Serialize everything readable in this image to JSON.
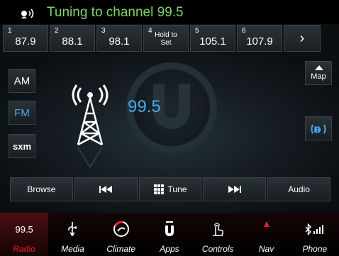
{
  "status": {
    "title": "Tuning to channel 99.5"
  },
  "presets": [
    {
      "num": "1",
      "freq": "87.9"
    },
    {
      "num": "2",
      "freq": "88.1"
    },
    {
      "num": "3",
      "freq": "98.1"
    },
    {
      "num": "4",
      "hold": "Hold to Set"
    },
    {
      "num": "5",
      "freq": "105.1"
    },
    {
      "num": "6",
      "freq": "107.9"
    }
  ],
  "next_glyph": "›",
  "side": {
    "am": "AM",
    "fm": "FM",
    "sxm": "sxm",
    "map": "Map"
  },
  "center": {
    "frequency": "99.5"
  },
  "controls": {
    "browse": "Browse",
    "tune": "Tune",
    "audio": "Audio"
  },
  "nav": {
    "radio_value": "99.5",
    "items": [
      "Radio",
      "Media",
      "Climate",
      "Apps",
      "Controls",
      "Nav",
      "Phone"
    ]
  },
  "colors": {
    "accent_blue": "#4aa8ea",
    "status_green": "#7fd36a",
    "active_red": "#e52222"
  }
}
